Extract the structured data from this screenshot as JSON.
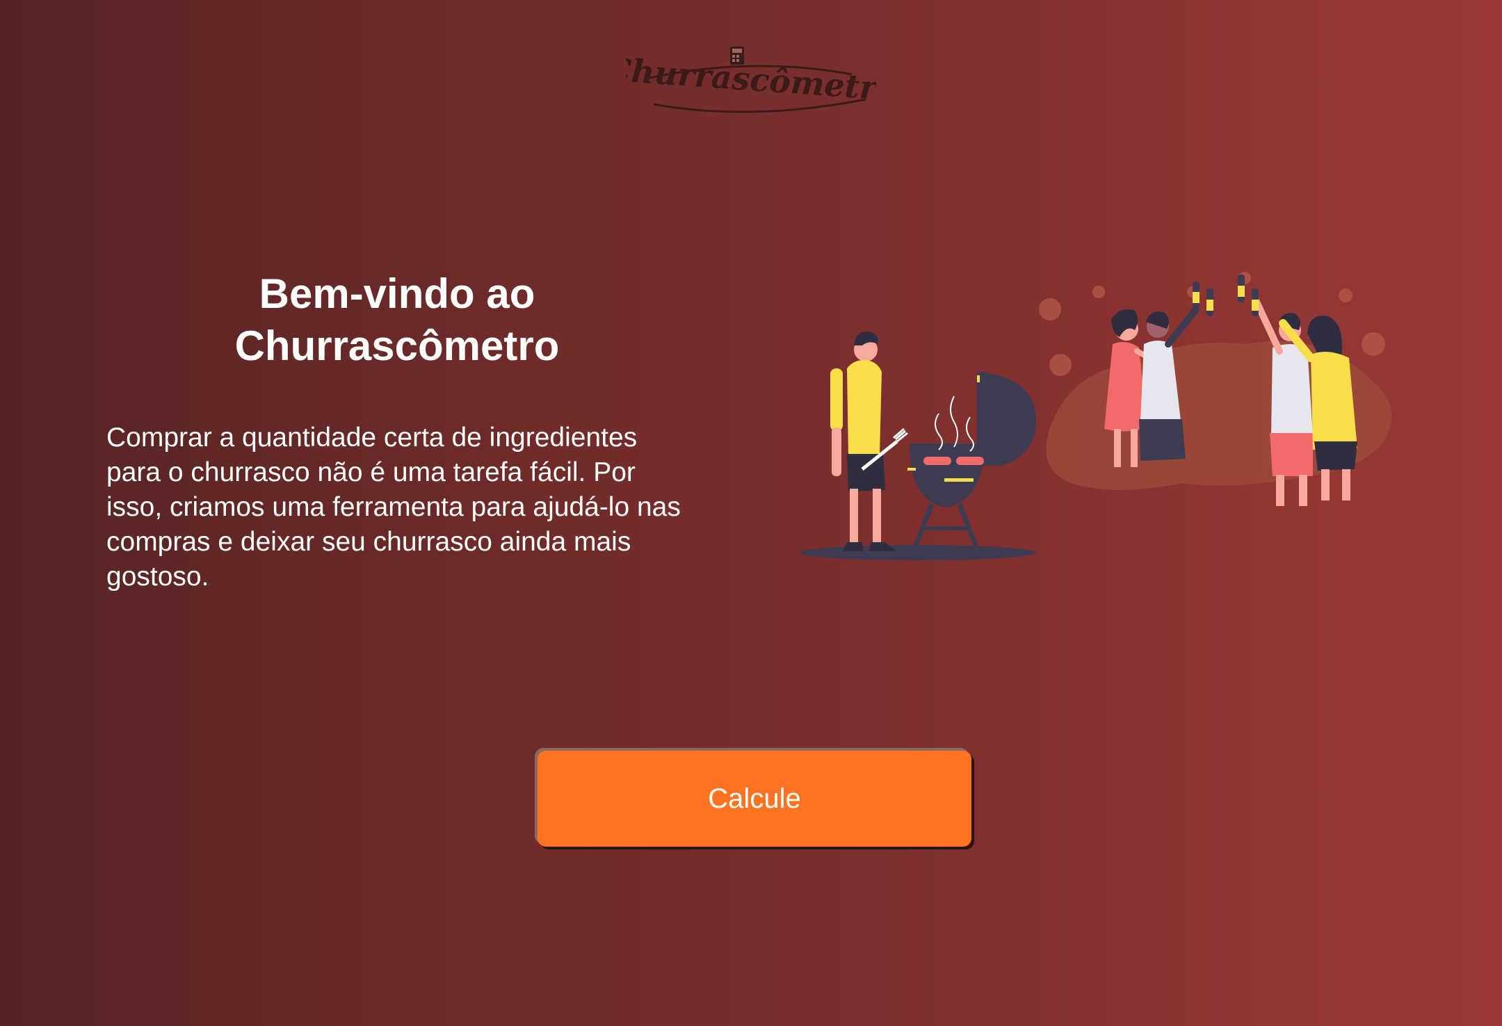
{
  "logo": {
    "text": "Churrascômetro",
    "icon": "calculator-icon"
  },
  "intro": {
    "title": "Bem-vindo ao Churrascômetro",
    "text": "Comprar a quantidade certa de ingredientes para o churrasco não é uma tarefa fácil. Por isso, criamos uma ferramenta para ajudá-lo nas compras e deixar seu churrasco ainda mais gostoso."
  },
  "cta": {
    "label": "Calcule"
  },
  "colors": {
    "accent": "#ff7322",
    "background_start": "#562424",
    "background_end": "#9a3a37",
    "text": "#ffffff",
    "logo": "#3a1b19"
  }
}
